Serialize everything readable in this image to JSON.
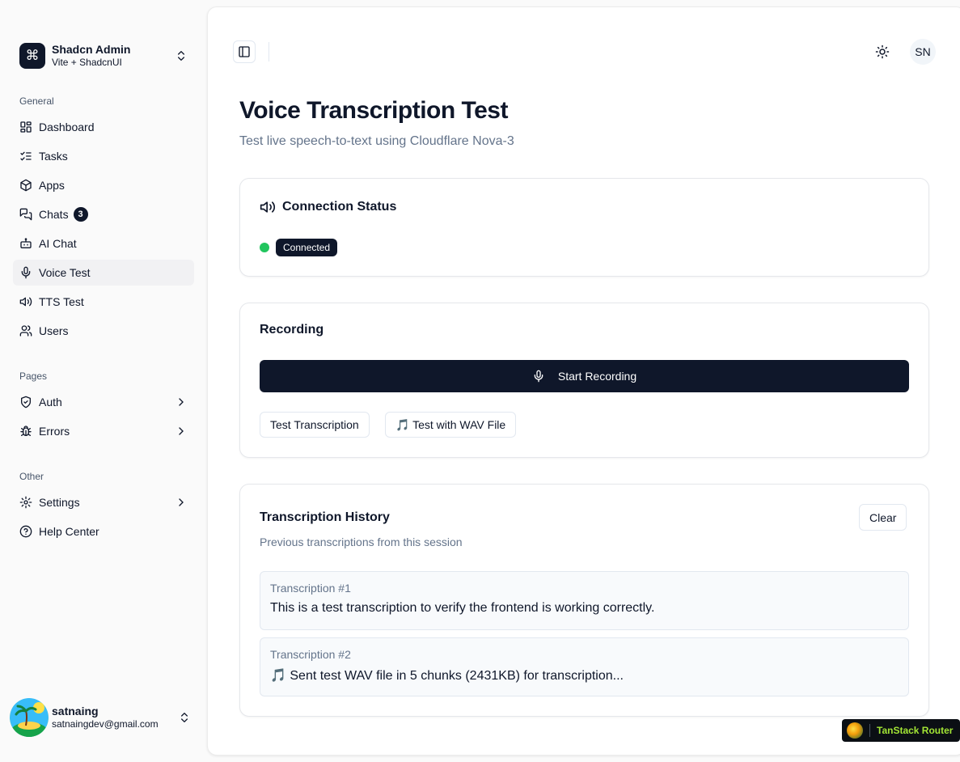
{
  "team": {
    "name": "Shadcn Admin",
    "subtitle": "Vite + ShadcnUI"
  },
  "sidebar": {
    "general_label": "General",
    "general": [
      {
        "label": "Dashboard",
        "icon": "layout-dashboard-icon"
      },
      {
        "label": "Tasks",
        "icon": "list-checks-icon"
      },
      {
        "label": "Apps",
        "icon": "package-icon"
      },
      {
        "label": "Chats",
        "icon": "messages-icon",
        "badge": "3"
      },
      {
        "label": "AI Chat",
        "icon": "bot-icon"
      },
      {
        "label": "Voice Test",
        "icon": "mic-icon",
        "active": true
      },
      {
        "label": "TTS Test",
        "icon": "volume-icon"
      },
      {
        "label": "Users",
        "icon": "users-icon"
      }
    ],
    "pages_label": "Pages",
    "pages": [
      {
        "label": "Auth",
        "icon": "shield-icon"
      },
      {
        "label": "Errors",
        "icon": "bug-icon"
      }
    ],
    "other_label": "Other",
    "other": [
      {
        "label": "Settings",
        "icon": "gear-icon"
      },
      {
        "label": "Help Center",
        "icon": "help-circle-icon"
      }
    ]
  },
  "user": {
    "name": "satnaing",
    "email": "satnaingdev@gmail.com"
  },
  "header": {
    "avatar_initials": "SN"
  },
  "page": {
    "title": "Voice Transcription Test",
    "subtitle": "Test live speech-to-text using Cloudflare Nova-3"
  },
  "connection": {
    "title": "Connection Status",
    "status": "Connected",
    "status_color": "#22c55e"
  },
  "recording": {
    "title": "Recording",
    "start_label": "Start Recording",
    "test_label": "Test Transcription",
    "wav_label": "🎵 Test with WAV File"
  },
  "history": {
    "title": "Transcription History",
    "description": "Previous transcriptions from this session",
    "clear_label": "Clear",
    "items": [
      {
        "label": "Transcription #1",
        "text": "This is a test transcription to verify the frontend is working correctly."
      },
      {
        "label": "Transcription #2",
        "text": "🎵 Sent test WAV file in 5 chunks (2431KB) for transcription..."
      }
    ]
  },
  "devtools": {
    "label": "TanStack Router"
  },
  "colors": {
    "primary": "#0f172a",
    "muted": "#64748b",
    "accent_green": "#a3e635"
  }
}
